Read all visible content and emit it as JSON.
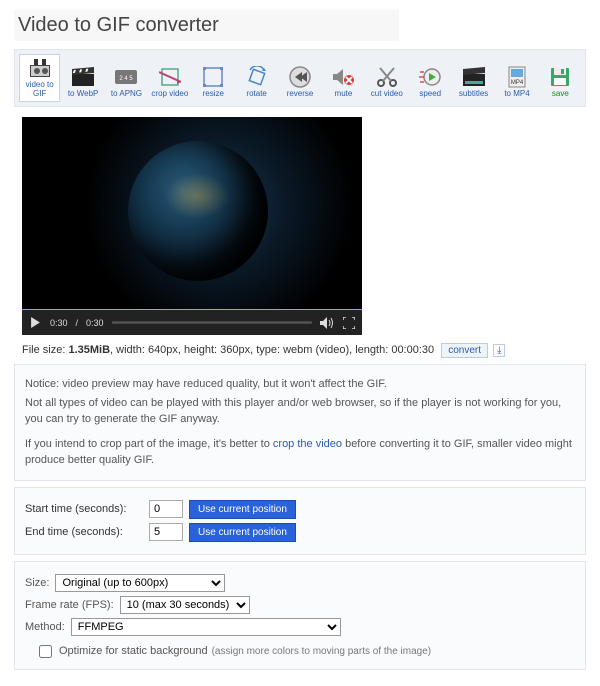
{
  "title": "Video to GIF converter",
  "toolbar": [
    {
      "key": "video-to-gif",
      "label": "video to\nGIF"
    },
    {
      "key": "to-webp",
      "label": "to WebP"
    },
    {
      "key": "to-apng",
      "label": "to APNG"
    },
    {
      "key": "crop-video",
      "label": "crop video"
    },
    {
      "key": "resize",
      "label": "resize"
    },
    {
      "key": "rotate",
      "label": "rotate"
    },
    {
      "key": "reverse",
      "label": "reverse"
    },
    {
      "key": "mute",
      "label": "mute"
    },
    {
      "key": "cut-video",
      "label": "cut video"
    },
    {
      "key": "speed",
      "label": "speed"
    },
    {
      "key": "subtitles",
      "label": "subtitles"
    },
    {
      "key": "to-mp4",
      "label": "to MP4"
    },
    {
      "key": "save",
      "label": "save"
    }
  ],
  "player": {
    "current_time": "0:30",
    "total_time": "0:30"
  },
  "fileinfo": {
    "prefix": "File size: ",
    "size": "1.35MiB",
    "rest": ", width: 640px, height: 360px, type: webm (video), length: 00:00:30",
    "convert": "convert",
    "download": "⤓"
  },
  "notice": {
    "l1": "Notice: video preview may have reduced quality, but it won't affect the GIF.",
    "l2": "Not all types of video can be played with this player and/or web browser, so if the player is not working for you, you can try to generate the GIF anyway.",
    "l3a": "If you intend to crop part of the image, it's better to ",
    "l3link": "crop the video",
    "l3b": " before converting it to GIF, smaller video might produce better quality GIF."
  },
  "time_form": {
    "start_label": "Start time (seconds):",
    "start_value": "0",
    "end_label": "End time (seconds):",
    "end_value": "5",
    "use_current": "Use current position"
  },
  "options": {
    "size_label": "Size:",
    "size_value": "Original (up to 600px)",
    "fps_label": "Frame rate (FPS):",
    "fps_value": "10 (max 30 seconds)",
    "method_label": "Method:",
    "method_value": "FFMPEG",
    "optimize_label": "Optimize for static background",
    "optimize_hint": "(assign more colors to moving parts of the image)"
  }
}
